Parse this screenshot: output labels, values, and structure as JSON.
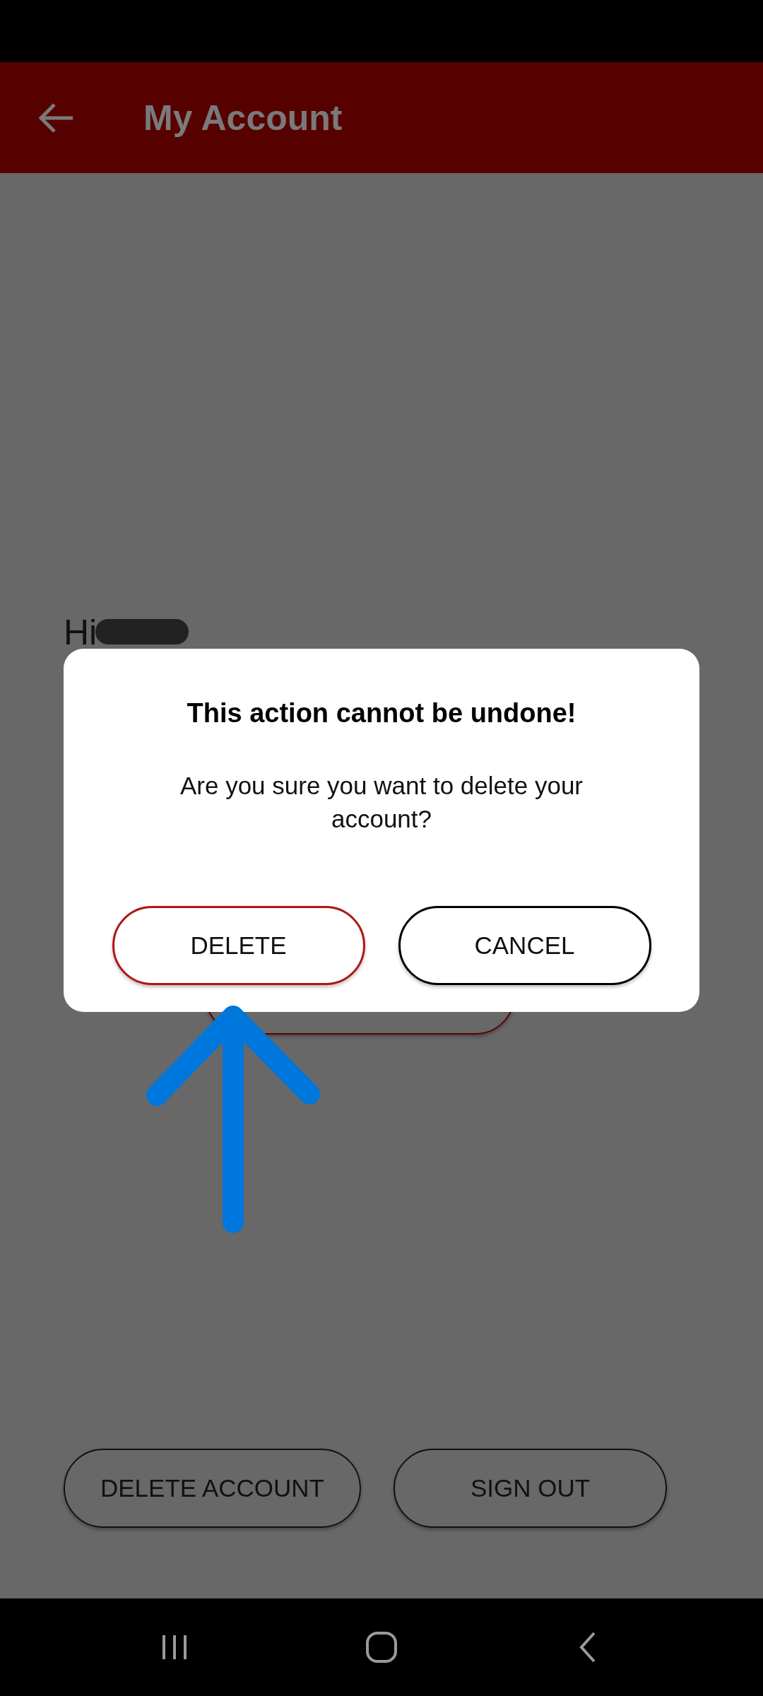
{
  "app_bar": {
    "title": "My Account"
  },
  "greeting": {
    "text": "Hi",
    "redacted": true
  },
  "dialog": {
    "title": "This action cannot be undone!",
    "message": "Are you sure you want to delete your account?",
    "buttons": [
      {
        "label": "DELETE",
        "kind": "destructive"
      },
      {
        "label": "CANCEL",
        "kind": "neutral"
      }
    ]
  },
  "actions": [
    {
      "label": "DELETE ACCOUNT"
    },
    {
      "label": "SIGN OUT"
    }
  ],
  "annotation": {
    "kind": "arrow"
  }
}
